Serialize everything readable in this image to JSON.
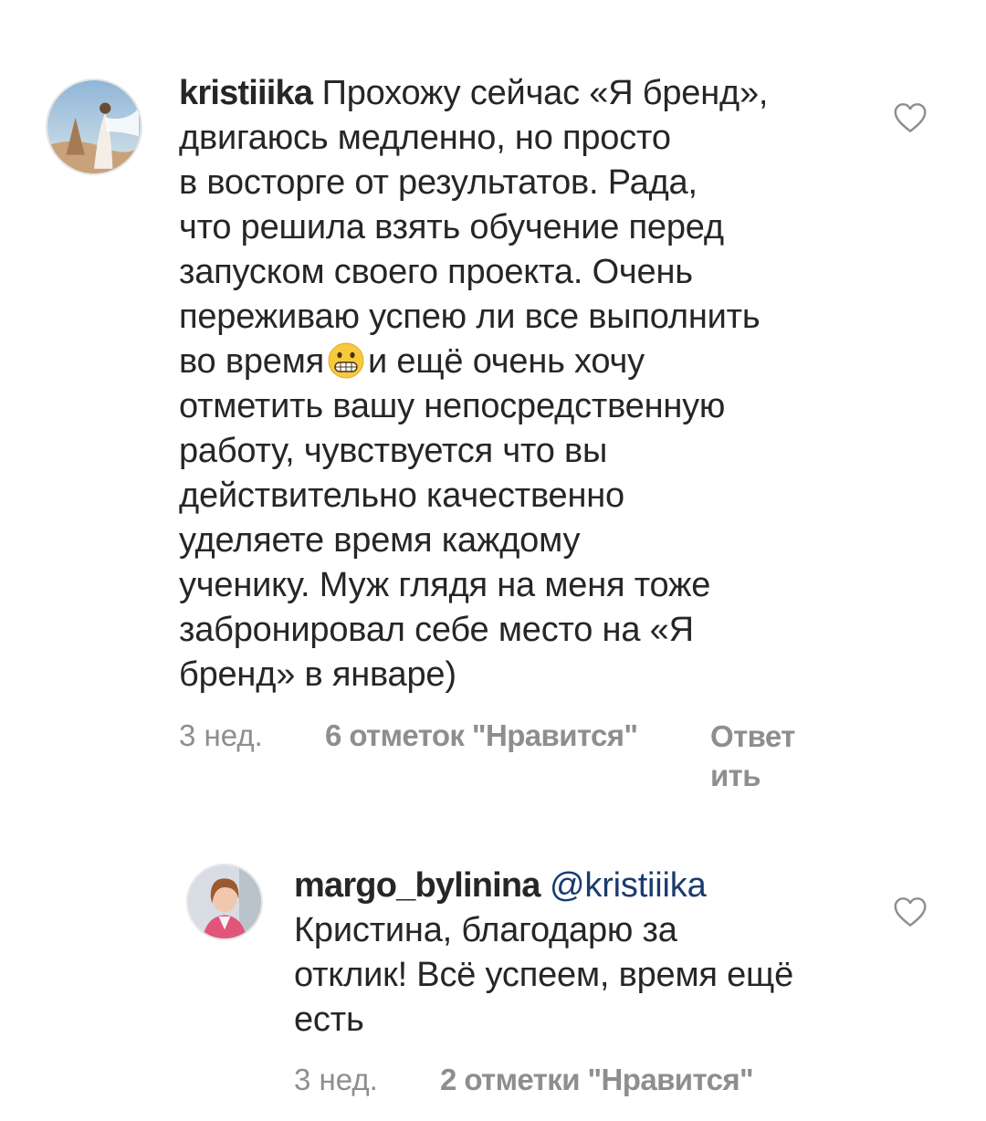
{
  "comments": [
    {
      "username": "kristiiika",
      "lines": [
        "Прохожу сейчас «Я бренд»,",
        "двигаюсь медленно, но просто",
        "в восторге от результатов. Рада,",
        "что решила взять обучение перед",
        "запуском своего проекта. Очень",
        "переживаю успею ли все выполнить"
      ],
      "emoji_line_before": "во время",
      "emoji_name": "grimacing-face-emoji",
      "emoji_line_after": "и ещё очень хочу",
      "lines_after": [
        "отметить вашу непосредственную",
        "работу, чувствуется что вы",
        "действительно качественно",
        "уделяете время каждому",
        "ученику. Муж глядя на меня тоже",
        "забронировал себе место на «Я",
        "бренд» в январе)"
      ],
      "time": "3 нед.",
      "likes": "6 отметок \"Нравится\"",
      "reply_line1": "Ответ",
      "reply_line2": "ить"
    },
    {
      "username": "margo_bylinina",
      "mention": "@kristiiika",
      "lines": [
        "Кристина, благодарю за",
        "отклик! Всё успеем, время ещё",
        "есть"
      ],
      "time": "3 нед.",
      "likes": "2 отметки \"Нравится\""
    }
  ],
  "icons": {
    "like": "heart-outline-icon"
  },
  "colors": {
    "text": "#262626",
    "meta": "#8e8e8e",
    "mention": "#1a3b6e"
  }
}
